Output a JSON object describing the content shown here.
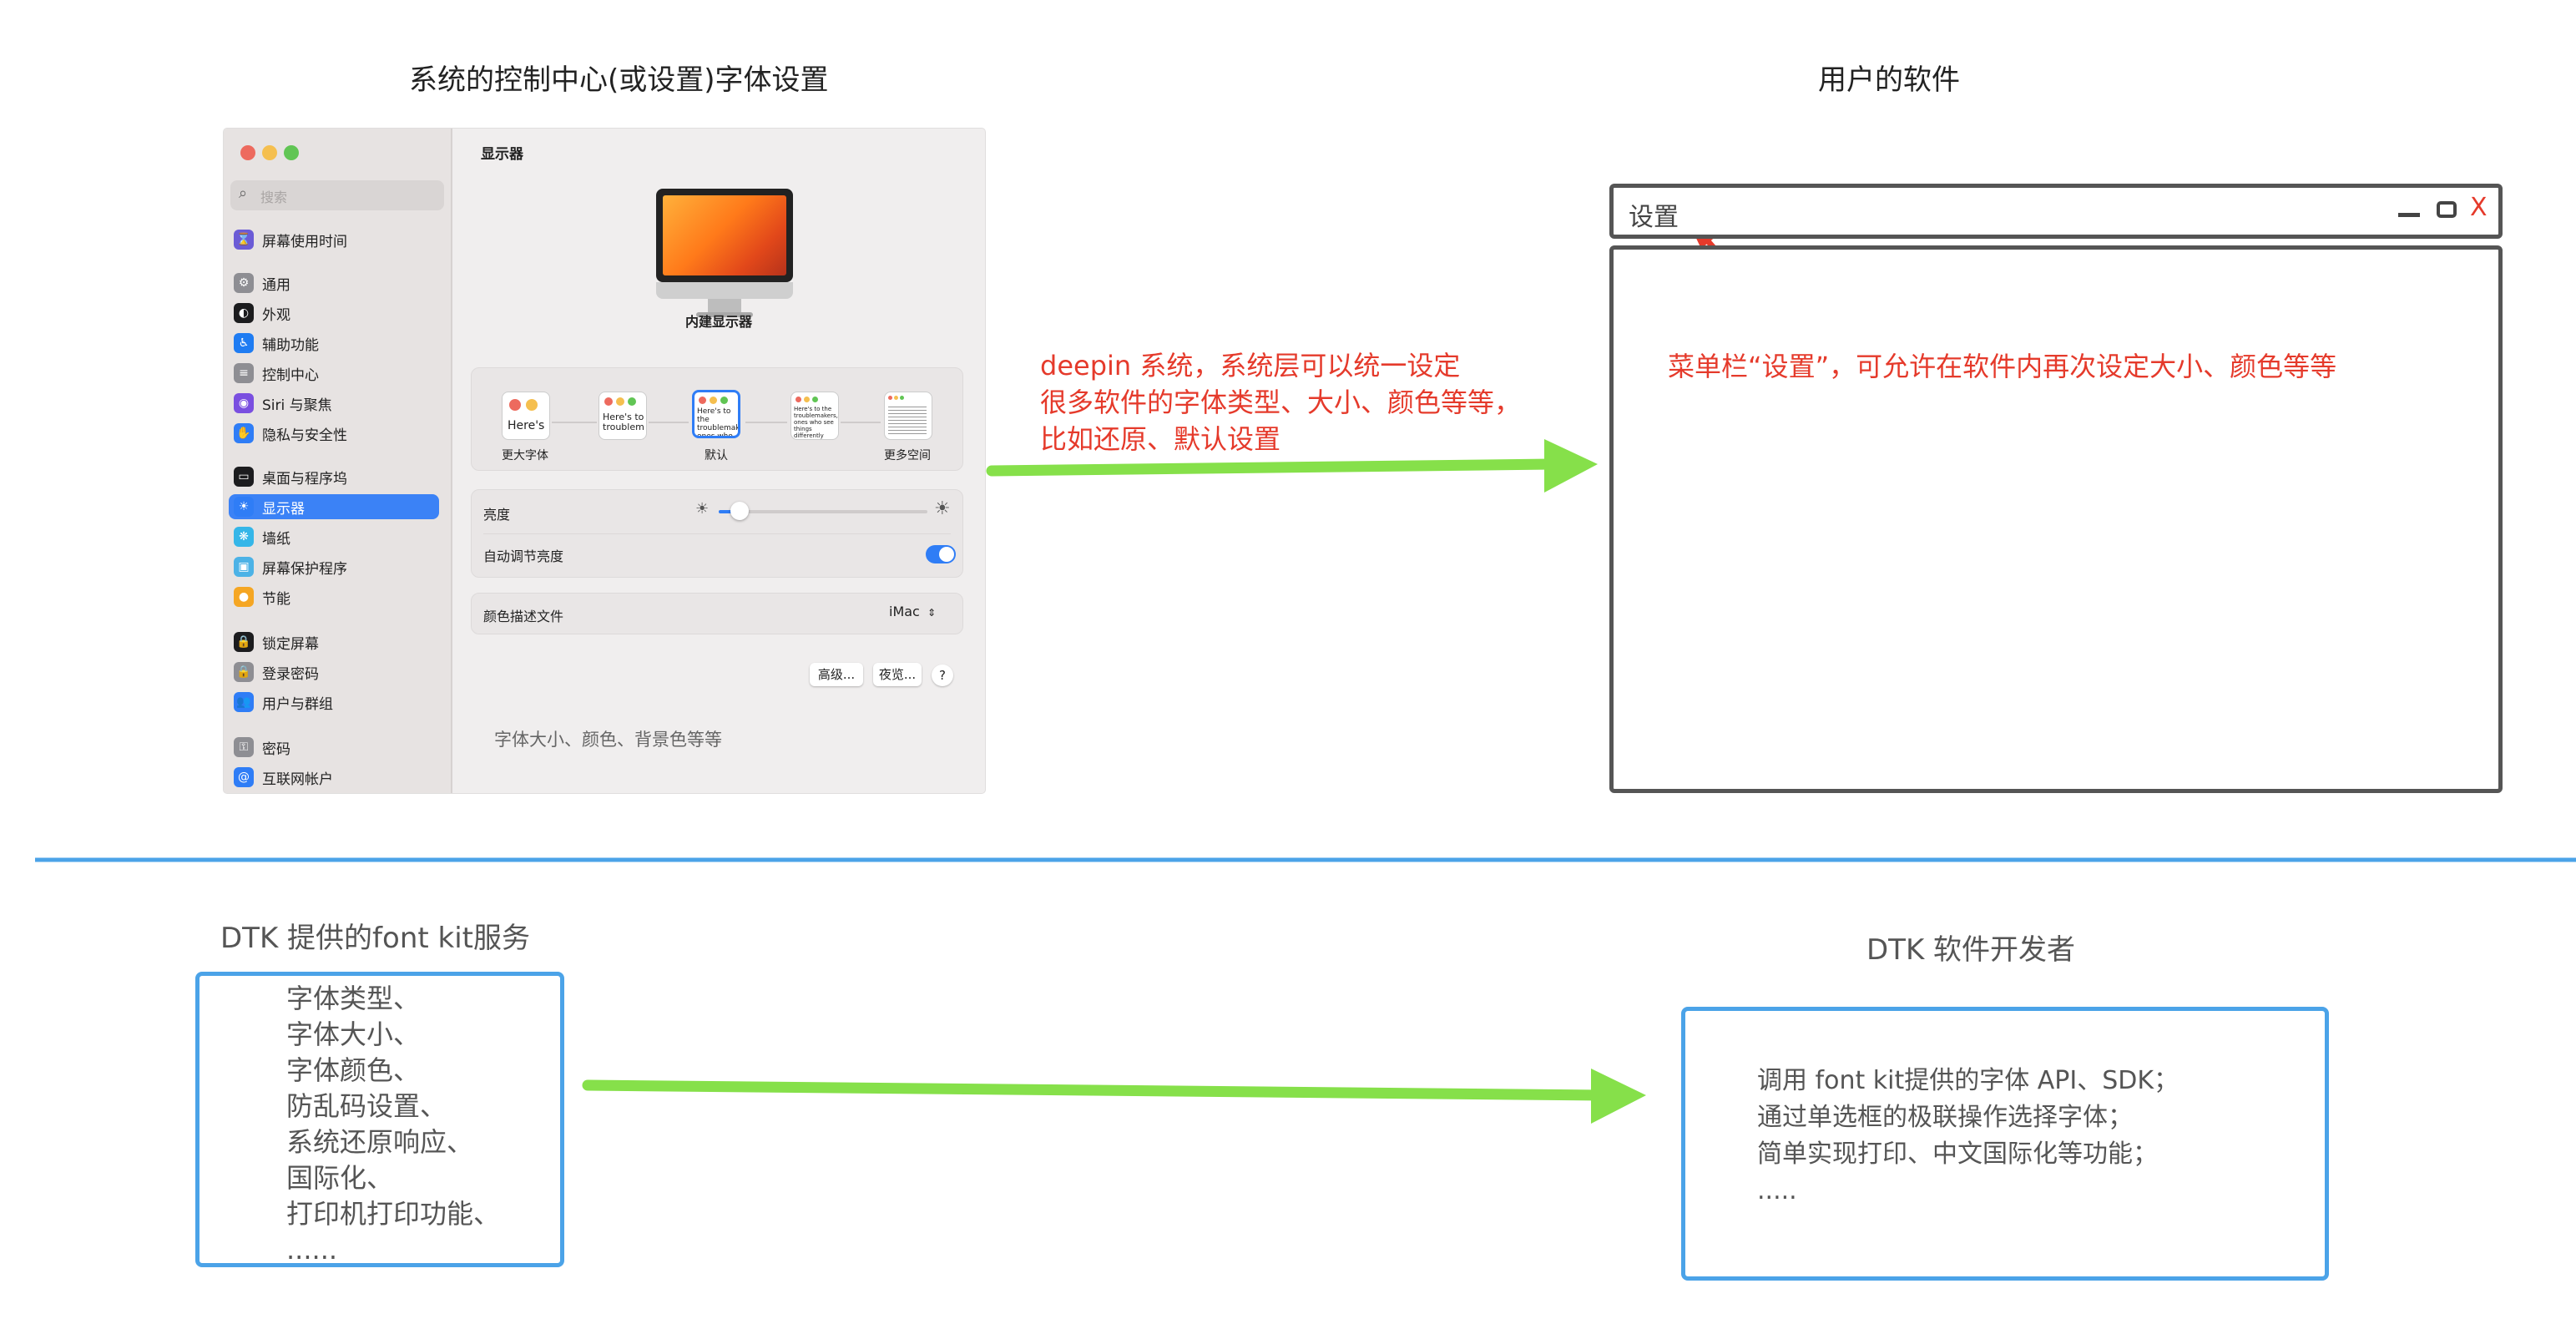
{
  "titles": {
    "system_settings": "系统的控制中心(或设置)字体设置",
    "user_software": "用户的软件",
    "dtk_service": "DTK 提供的font kit服务",
    "dtk_developer": "DTK 软件开发者"
  },
  "mac_window": {
    "search_placeholder": "搜索",
    "sidebar": [
      {
        "label": "屏幕使用时间",
        "icon": "hourglass-icon",
        "color": "#6b5bd6"
      },
      {
        "label": "通用",
        "icon": "gear-icon",
        "color": "#8e8e93"
      },
      {
        "label": "外观",
        "icon": "appearance-icon",
        "color": "#1c1c1e"
      },
      {
        "label": "辅助功能",
        "icon": "accessibility-icon",
        "color": "#1f7cf2"
      },
      {
        "label": "控制中心",
        "icon": "control-center-icon",
        "color": "#8e8e93"
      },
      {
        "label": "Siri 与聚焦",
        "icon": "siri-icon",
        "color": "#7a4fe0"
      },
      {
        "label": "隐私与安全性",
        "icon": "hand-icon",
        "color": "#2f7df6"
      },
      {
        "label": "桌面与程序坞",
        "icon": "dock-icon",
        "color": "#1c1c1e"
      },
      {
        "label": "显示器",
        "icon": "sun-icon",
        "color": "#2f7df6"
      },
      {
        "label": "墙纸",
        "icon": "wallpaper-icon",
        "color": "#35b6e8"
      },
      {
        "label": "屏幕保护程序",
        "icon": "screensaver-icon",
        "color": "#4cb2e6"
      },
      {
        "label": "节能",
        "icon": "bulb-icon",
        "color": "#f5a623"
      },
      {
        "label": "锁定屏幕",
        "icon": "lock-icon",
        "color": "#1c1c1e"
      },
      {
        "label": "登录密码",
        "icon": "lock-icon",
        "color": "#8e8e93"
      },
      {
        "label": "用户与群组",
        "icon": "users-icon",
        "color": "#2f7df6"
      },
      {
        "label": "密码",
        "icon": "key-icon",
        "color": "#8e8e93"
      },
      {
        "label": "互联网帐户",
        "icon": "at-icon",
        "color": "#2f7df6"
      }
    ],
    "active_index": 8,
    "header": "显示器",
    "display_name": "内建显示器",
    "preview_text": "Here's",
    "preview_text_2": "Here's to troublem",
    "preview_text_3": "Here's to the troublemakers, ones who",
    "preview_text_4": "Here's to the troublemakers, ones who see things differently",
    "resolution_labels": [
      "更大字体",
      "默认",
      "更多空间"
    ],
    "brightness_label": "亮度",
    "brightness_level": 0.1,
    "auto_brightness_label": "自动调节亮度",
    "auto_brightness_on": true,
    "color_profile_label": "颜色描述文件",
    "color_profile_value": "iMac",
    "advanced_button": "高级...",
    "night_shift_button": "夜览...",
    "help_button": "?",
    "note": "字体大小、颜色、背景色等等"
  },
  "arrow_note": {
    "line1": "deepin 系统，系统层可以统一设定",
    "line2": "很多软件的字体类型、大小、颜色等等，",
    "line3": "比如还原、默认设置"
  },
  "app_window": {
    "menu_label": "设置",
    "minimize": "—",
    "close": "X",
    "annotation": "菜单栏“设置”，可允许在软件内再次设定大小、颜色等等"
  },
  "dtk_service_items": [
    "字体类型、",
    "字体大小、",
    "字体颜色、",
    "防乱码设置、",
    "系统还原响应、",
    "国际化、",
    "打印机打印功能、",
    "......"
  ],
  "dtk_developer_items": [
    "调用 font kit提供的字体 API、SDK；",
    "通过单选框的极联操作选择字体；",
    "简单实现打印、中文国际化等功能；",
    "....."
  ],
  "colors": {
    "arrow_green": "#86e04a",
    "divider_blue": "#4ba3e8",
    "annotation_red": "#e53a2b",
    "active_blue": "#3b82f6"
  }
}
